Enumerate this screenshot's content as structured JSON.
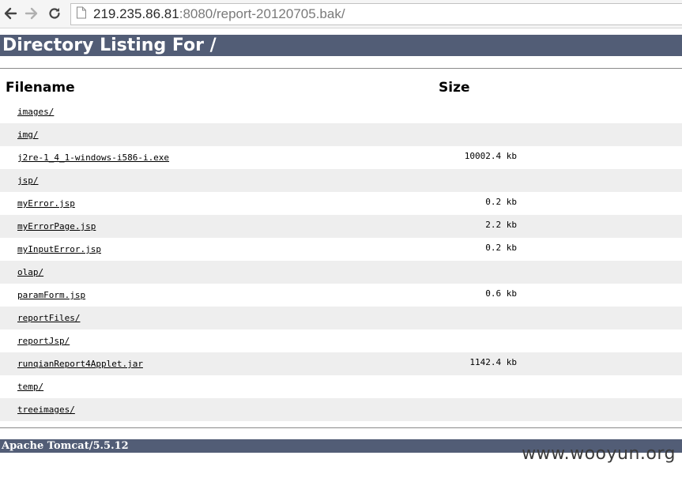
{
  "browser": {
    "url_host": "219.235.86.81",
    "url_rest": ":8080/report-20120705.bak/",
    "icons": {
      "back": "back-arrow-icon",
      "forward": "forward-arrow-icon",
      "reload": "reload-icon",
      "page": "page-icon"
    }
  },
  "page": {
    "title": "Directory Listing For /",
    "columns": {
      "filename": "Filename",
      "size": "Size"
    },
    "files": [
      {
        "name": "images/",
        "size": ""
      },
      {
        "name": "img/",
        "size": ""
      },
      {
        "name": "j2re-1_4_1-windows-i586-i.exe",
        "size": "10002.4 kb"
      },
      {
        "name": "jsp/",
        "size": ""
      },
      {
        "name": "myError.jsp",
        "size": "0.2 kb"
      },
      {
        "name": "myErrorPage.jsp",
        "size": "2.2 kb"
      },
      {
        "name": "myInputError.jsp",
        "size": "0.2 kb"
      },
      {
        "name": "olap/",
        "size": ""
      },
      {
        "name": "paramForm.jsp",
        "size": "0.6 kb"
      },
      {
        "name": "reportFiles/",
        "size": ""
      },
      {
        "name": "reportJsp/",
        "size": ""
      },
      {
        "name": "runqianReport4Applet.jar",
        "size": "1142.4 kb"
      },
      {
        "name": "temp/",
        "size": ""
      },
      {
        "name": "treeimages/",
        "size": ""
      }
    ],
    "footer": "Apache Tomcat/5.5.12"
  },
  "watermark": "www.wooyun.org",
  "colors": {
    "header_bar": "#525d76",
    "alt_row": "#eeeeee"
  }
}
